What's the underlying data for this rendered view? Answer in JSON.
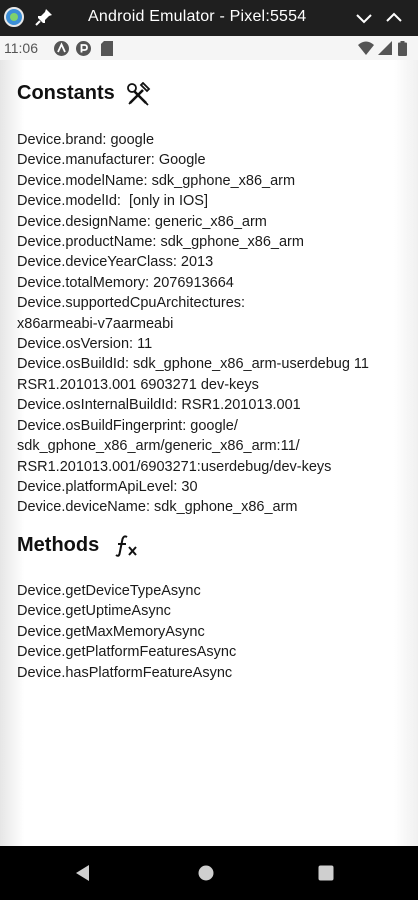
{
  "window": {
    "title": "Android Emulator - Pixel:5554"
  },
  "statusbar": {
    "time": "11:06",
    "icons": [
      "notification-a-icon",
      "notification-p-icon",
      "sd-card-icon",
      "wifi-icon",
      "signal-icon",
      "battery-icon"
    ]
  },
  "constants": {
    "title": "Constants",
    "icon": "tools-icon",
    "lines": [
      "Device.brand: google",
      "Device.manufacturer: Google",
      "Device.modelName: sdk_gphone_x86_arm",
      "Device.modelId:  [only in IOS]",
      "Device.designName: generic_x86_arm",
      "Device.productName: sdk_gphone_x86_arm",
      "Device.deviceYearClass: 2013",
      "Device.totalMemory: 2076913664",
      "Device.supportedCpuArchitectures:",
      "x86armeabi-v7aarmeabi",
      "Device.osVersion: 11",
      "Device.osBuildId: sdk_gphone_x86_arm-userdebug 11",
      "RSR1.201013.001 6903271 dev-keys",
      "Device.osInternalBuildId: RSR1.201013.001",
      "Device.osBuildFingerprint: google/",
      "sdk_gphone_x86_arm/generic_x86_arm:11/",
      "RSR1.201013.001/6903271:userdebug/dev-keys",
      "Device.platformApiLevel: 30",
      "Device.deviceName: sdk_gphone_x86_arm"
    ]
  },
  "methods": {
    "title": "Methods",
    "icon": "function-icon",
    "items": [
      "Device.getDeviceTypeAsync",
      "Device.getUptimeAsync",
      "Device.getMaxMemoryAsync",
      "Device.getPlatformFeaturesAsync",
      "Device.hasPlatformFeatureAsync"
    ]
  },
  "navbar": {
    "buttons": [
      "back-icon",
      "home-icon",
      "recents-icon"
    ]
  }
}
